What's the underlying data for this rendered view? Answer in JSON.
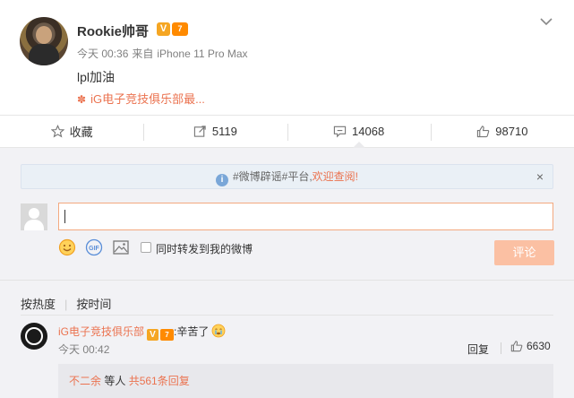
{
  "post": {
    "username": "Rookie帅哥",
    "verified_badge": "V",
    "vip_badge": "7",
    "timestamp": "今天 00:36",
    "source_prefix": "来自",
    "source": "iPhone 11 Pro Max",
    "text": "lpl加油",
    "topic_icon": "✽",
    "topic": "iG电子竞技俱乐部最..."
  },
  "actions": {
    "favorite": "收藏",
    "repost_count": "5119",
    "comment_count": "14068",
    "like_count": "98710"
  },
  "comment_box": {
    "notice_prefix": "#微博辟谣#平台,",
    "notice_link": "欢迎查阅!",
    "notice_close": "×",
    "repost_label": "同时转发到我的微博",
    "submit_label": "评论"
  },
  "sort": {
    "hot": "按热度",
    "time": "按时间"
  },
  "comment": {
    "author": "iG电子竞技俱乐部",
    "text": ":辛苦了",
    "time": "今天 00:42",
    "reply_label": "回复",
    "likes": "6630",
    "sub_reply_user": "不二余",
    "sub_reply_mid": " 等人 ",
    "sub_reply_more": "共561条回复"
  },
  "colors": {
    "accent": "#eb7350",
    "submit_disabled": "#fbc0a3",
    "comment_bg": "#f2f2f5"
  }
}
